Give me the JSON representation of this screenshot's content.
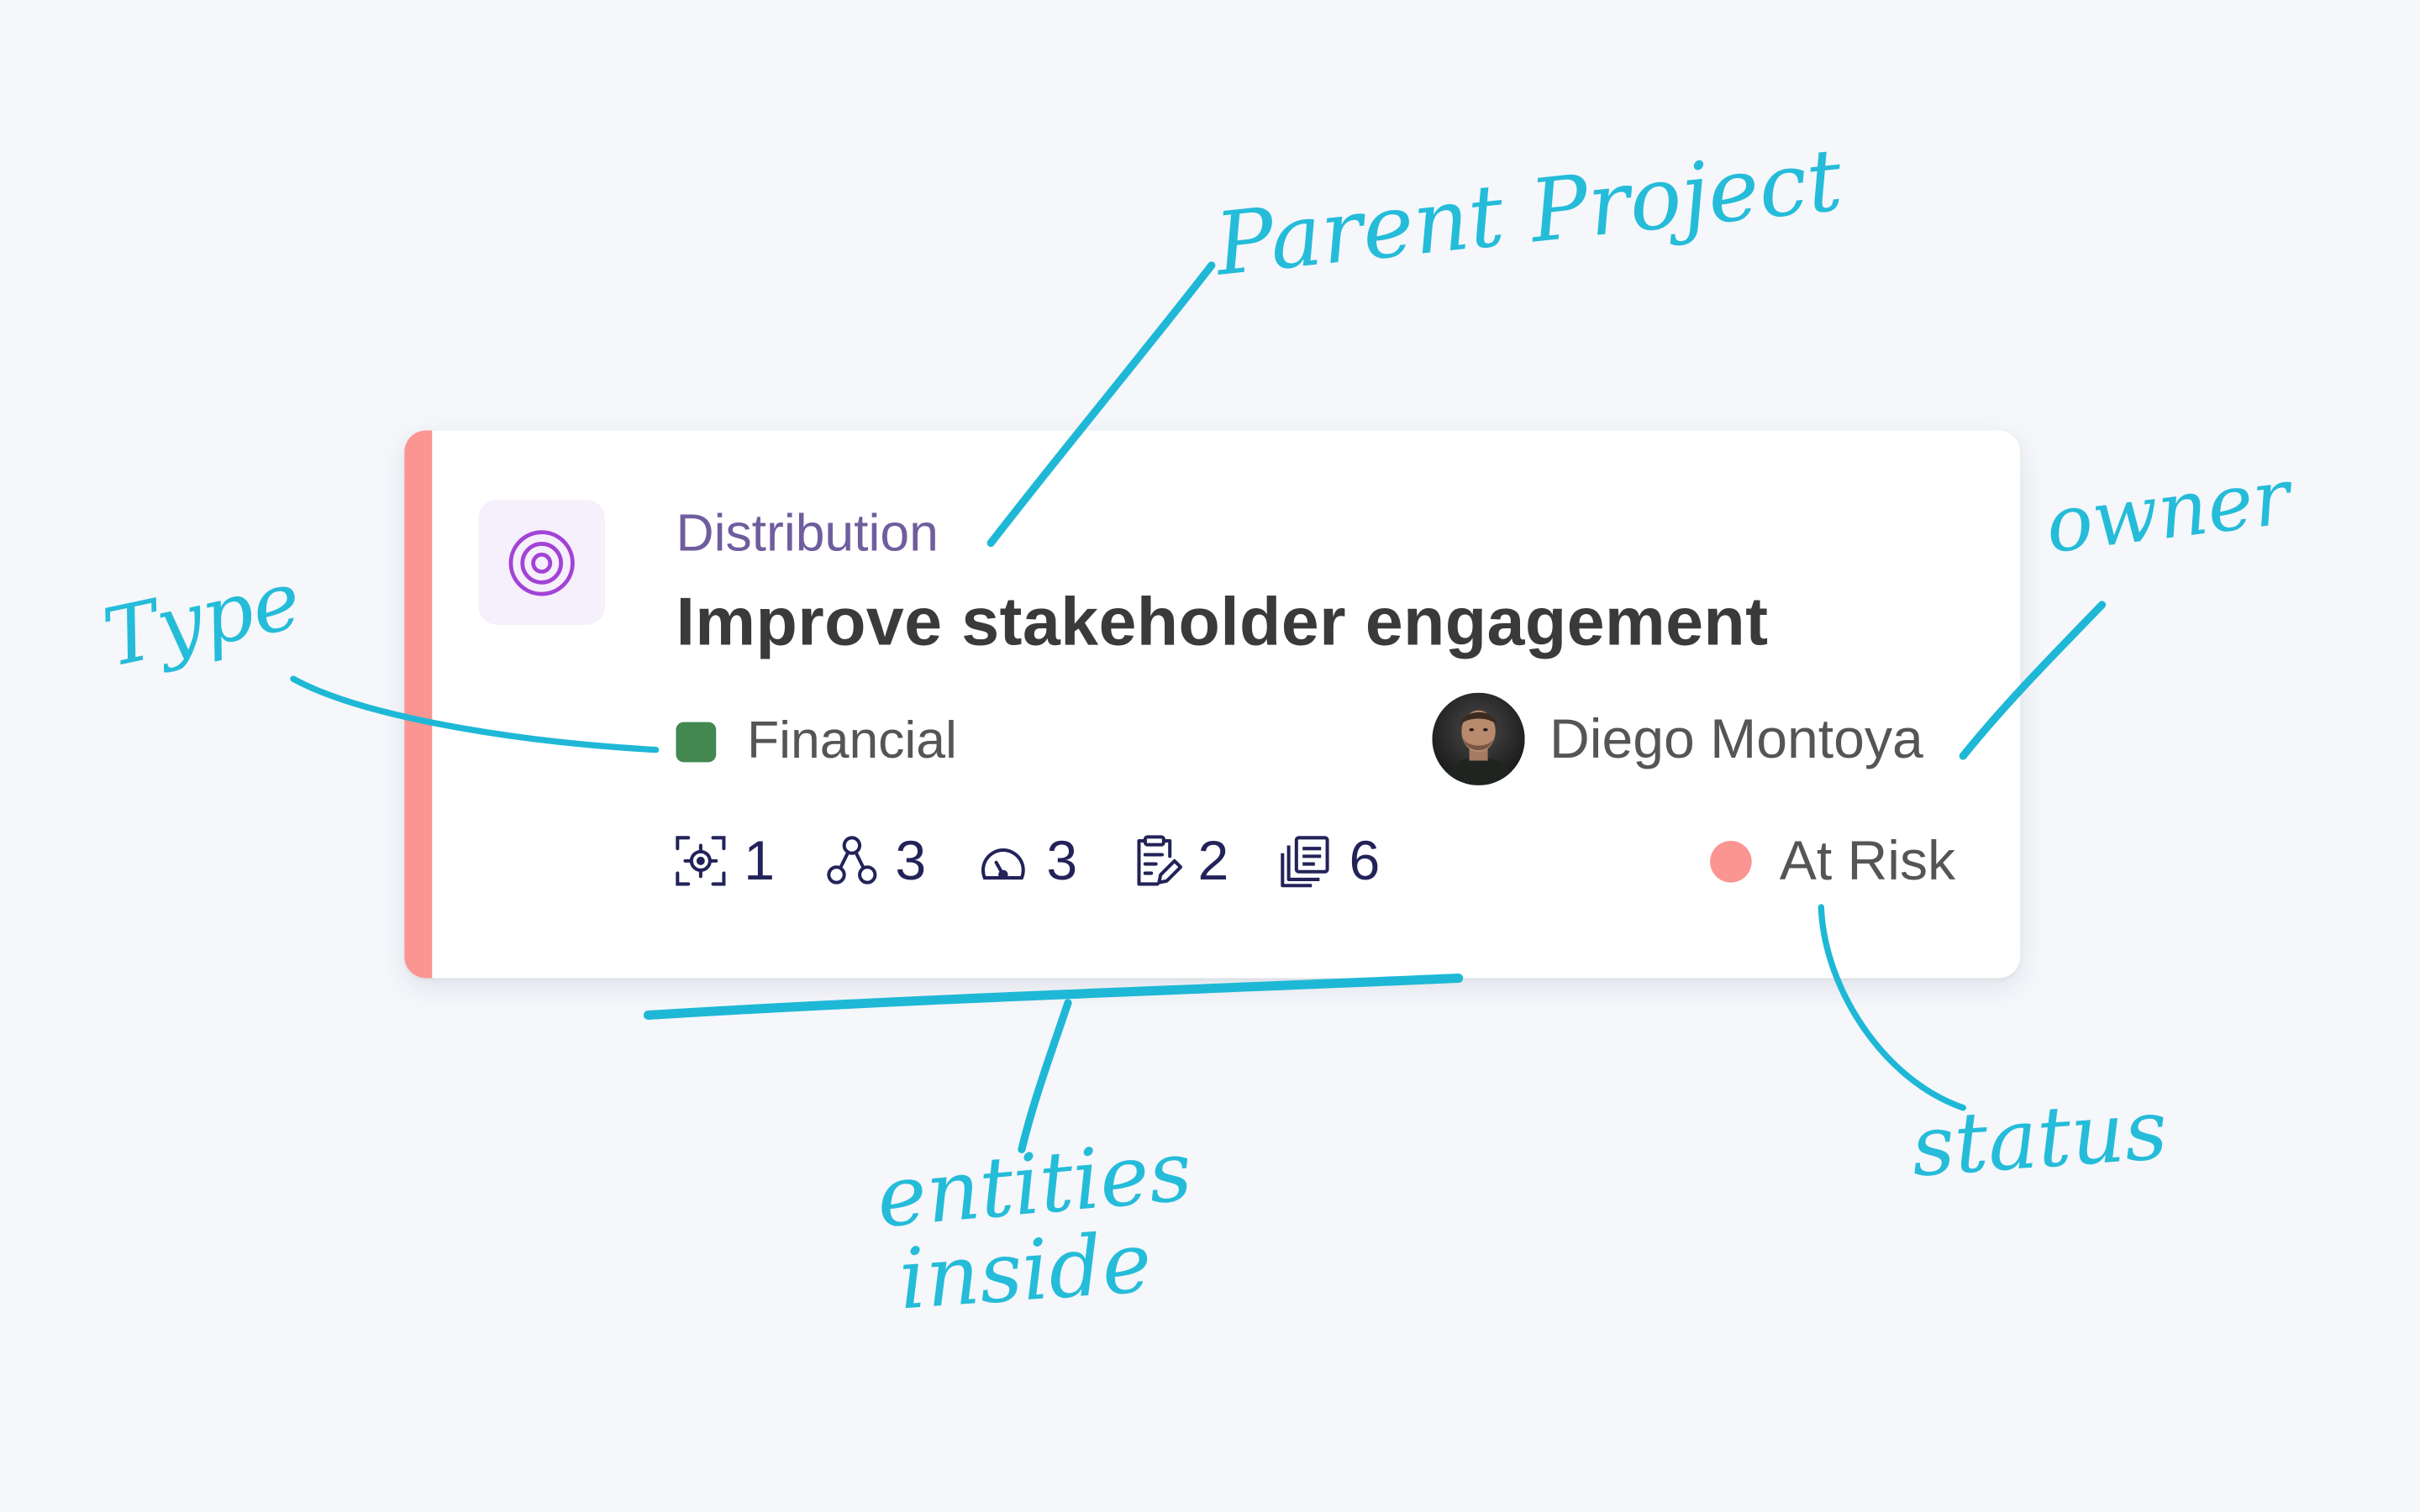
{
  "card": {
    "accent_color": "#fb9592",
    "type_icon": "target-icon",
    "type_icon_color": "#a243d6",
    "type_tile_color": "#f6effc",
    "parent_project": "Distribution",
    "parent_project_color": "#6f5d9e",
    "title": "Improve stakeholder engagement",
    "category": {
      "label": "Financial",
      "color": "#428850"
    },
    "owner": {
      "name": "Diego Montoya",
      "avatar": "avatar-photo"
    },
    "entities": [
      {
        "icon": "focus-target-icon",
        "count": "1"
      },
      {
        "icon": "hierarchy-nodes-icon",
        "count": "3"
      },
      {
        "icon": "gauge-icon",
        "count": "3"
      },
      {
        "icon": "clipboard-edit-icon",
        "count": "2"
      },
      {
        "icon": "document-stack-icon",
        "count": "6"
      }
    ],
    "entity_icon_color": "#23235a",
    "status": {
      "label": "At Risk",
      "color": "#fb9592"
    }
  },
  "annotations": {
    "color": "#1eb8d6",
    "parent_project": "Parent Project",
    "owner": "owner",
    "type": "Type",
    "entities_line1": "entities",
    "entities_line2": "inside",
    "status": "status"
  }
}
